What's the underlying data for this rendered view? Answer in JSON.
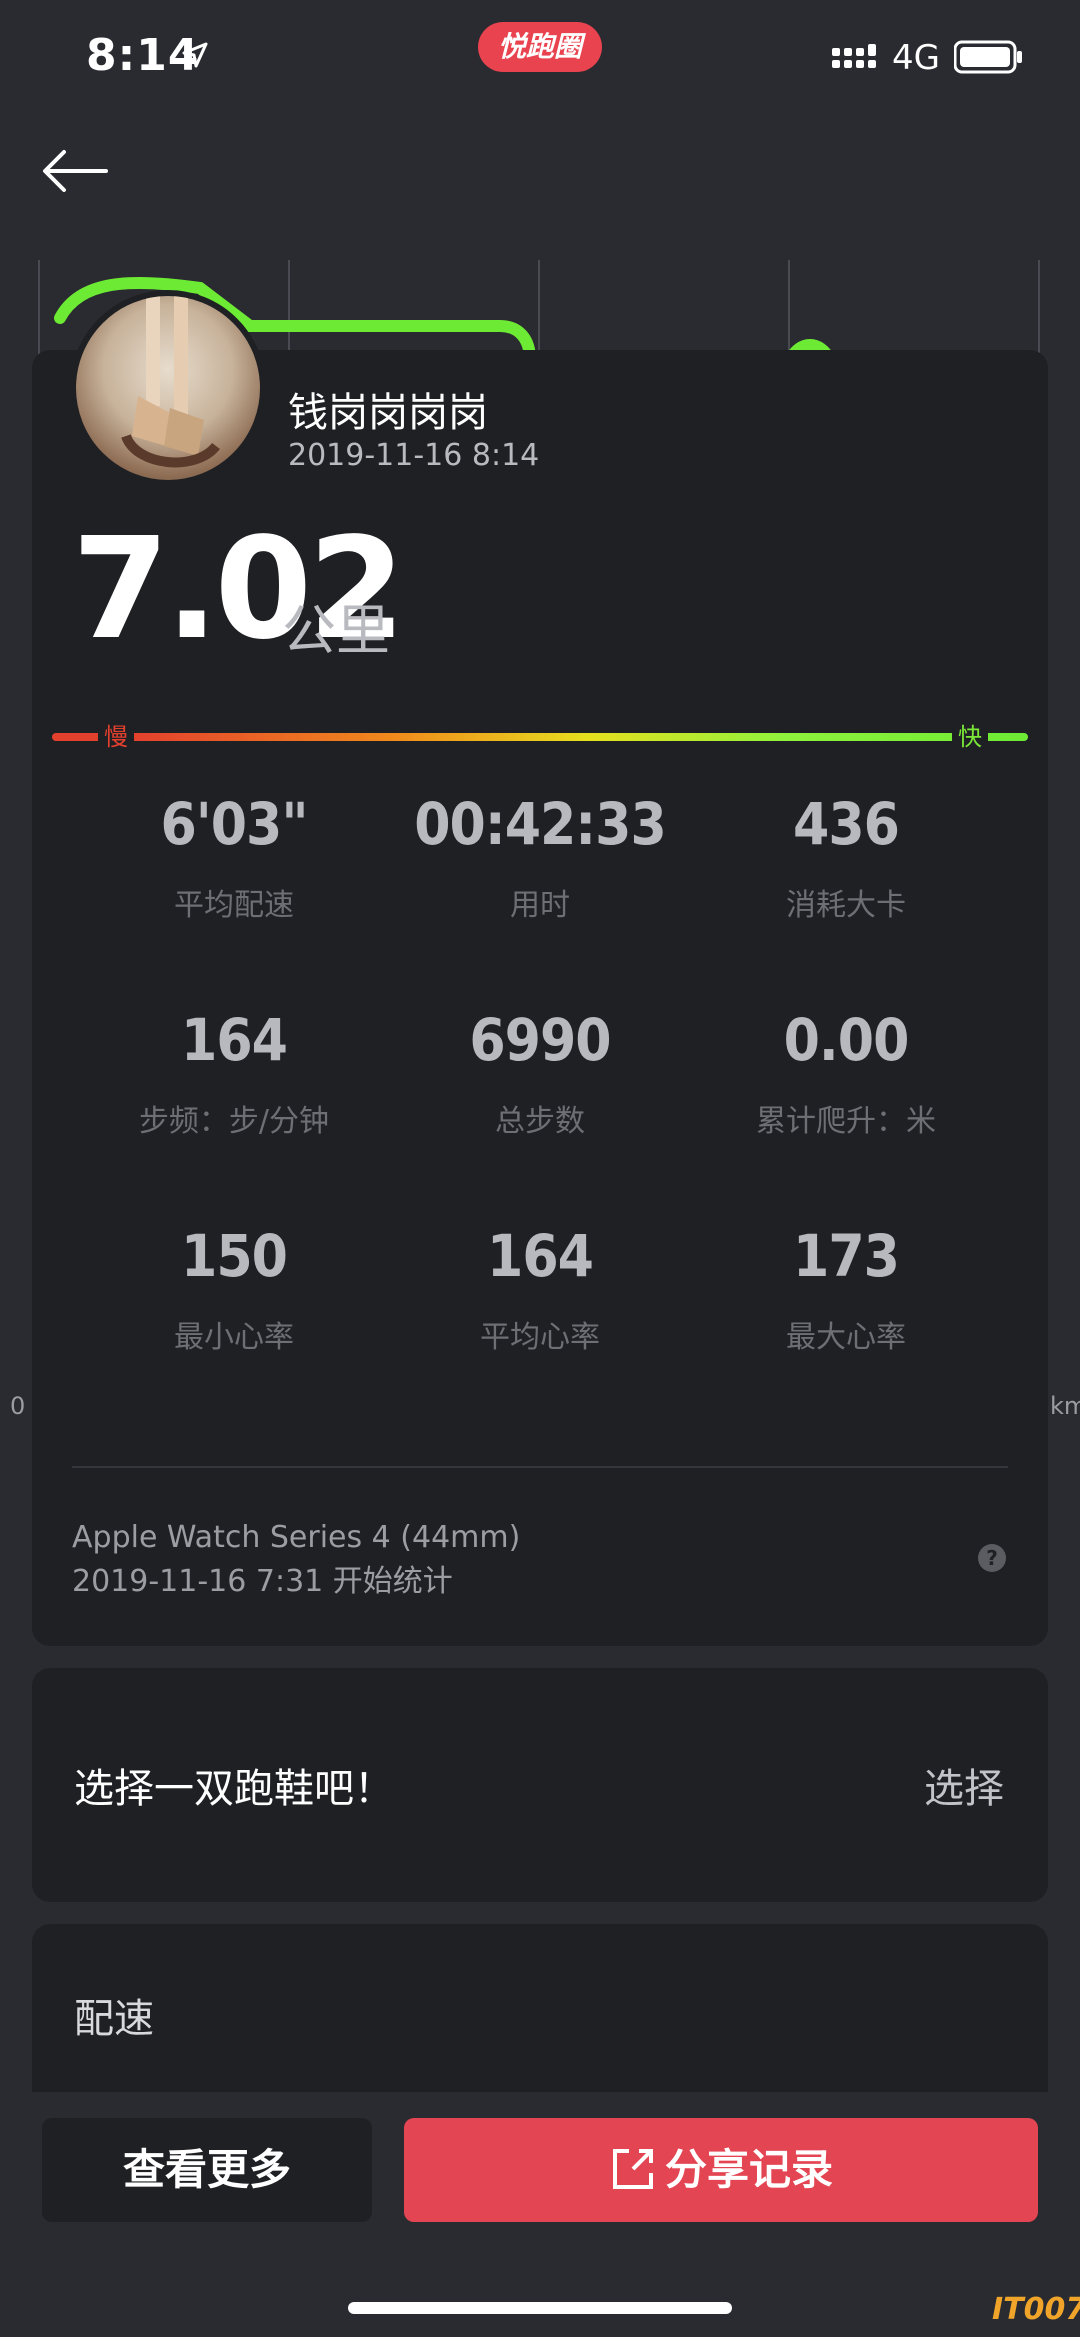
{
  "status_bar": {
    "time": "8:14",
    "network": "4G",
    "app_badge": "悦跑圈"
  },
  "chart_axis": {
    "start": "0",
    "end": "km"
  },
  "user": {
    "name": "钱岗岗岗岗",
    "date": "2019-11-16 8:14"
  },
  "distance": {
    "value": "7.02",
    "unit": "公里"
  },
  "speed_bar": {
    "slow": "慢",
    "fast": "快"
  },
  "stats": [
    {
      "value": "6'03\"",
      "label": "平均配速"
    },
    {
      "value": "00:42:33",
      "label": "用时"
    },
    {
      "value": "436",
      "label": "消耗大卡"
    },
    {
      "value": "164",
      "label": "步频：步/分钟"
    },
    {
      "value": "6990",
      "label": "总步数"
    },
    {
      "value": "0.00",
      "label": "累计爬升：米"
    },
    {
      "value": "150",
      "label": "最小心率"
    },
    {
      "value": "164",
      "label": "平均心率"
    },
    {
      "value": "173",
      "label": "最大心率"
    }
  ],
  "device": {
    "name": "Apple Watch Series 4 (44mm)",
    "start": "2019-11-16 7:31 开始统计",
    "help": "?"
  },
  "shoe": {
    "prompt": "选择一双跑鞋吧！",
    "select": "选择"
  },
  "pace": {
    "title": "配速"
  },
  "actions": {
    "more": "查看更多",
    "share": "分享记录"
  },
  "watermark": "IT007",
  "colors": {
    "accent": "#e44552",
    "slow": "#e3402e",
    "fast": "#6dea34",
    "card": "#1f2024",
    "background": "#2a2b30"
  }
}
